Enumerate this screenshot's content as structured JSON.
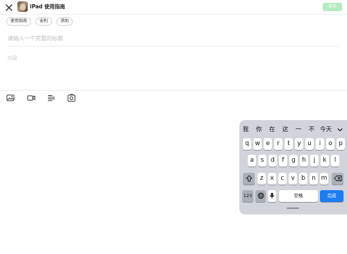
{
  "header": {
    "channel_name": "iPad 使用指南",
    "publish_label": "发布"
  },
  "tags": [
    "使用指南",
    "安利",
    "求助"
  ],
  "editor": {
    "title_placeholder": "请输入一个完整的标题",
    "content_placeholder": "内容"
  },
  "toolbar": {
    "icons": [
      "image-icon",
      "video-icon",
      "text-format-icon",
      "photo-album-icon"
    ]
  },
  "keyboard": {
    "candidates": [
      "我",
      "你",
      "在",
      "这",
      "一",
      "不",
      "今天"
    ],
    "row1": [
      "q",
      "w",
      "e",
      "r",
      "t",
      "y",
      "u",
      "i",
      "o",
      "p"
    ],
    "row2": [
      "a",
      "s",
      "d",
      "f",
      "g",
      "h",
      "j",
      "k",
      "l"
    ],
    "row3": [
      "z",
      "x",
      "c",
      "v",
      "b",
      "n",
      "m"
    ],
    "num_label": "123",
    "space_label": "空格",
    "done_label": "完成"
  },
  "colors": {
    "publish_bg": "#b3ebc2",
    "done_bg": "#1a7df5",
    "keyboard_bg": "#d1d4da"
  }
}
